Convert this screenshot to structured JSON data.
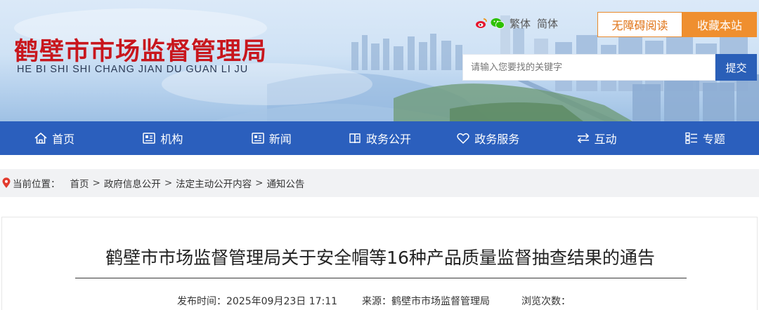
{
  "site": {
    "title": "鹤壁市市场监督管理局",
    "pinyin": "HE BI SHI SHI CHANG JIAN DU GUAN LI JU"
  },
  "header": {
    "lang_traditional": "繁体",
    "lang_simplified": "简体",
    "accessibility_label": "无障碍阅读",
    "favorite_label": "收藏本站",
    "search_placeholder": "请输入您要找的关键字",
    "search_button": "提交",
    "social_icons": [
      "weibo-icon",
      "wechat-icon"
    ]
  },
  "nav": {
    "items": [
      {
        "label": "首页",
        "icon": "home-icon"
      },
      {
        "label": "机构",
        "icon": "org-icon"
      },
      {
        "label": "新闻",
        "icon": "news-icon"
      },
      {
        "label": "政务公开",
        "icon": "gov-open-icon"
      },
      {
        "label": "政务服务",
        "icon": "heart-icon"
      },
      {
        "label": "互动",
        "icon": "interact-icon"
      },
      {
        "label": "专题",
        "icon": "topic-icon"
      }
    ]
  },
  "breadcrumb": {
    "label": "当前位置：",
    "items": [
      "首页",
      "政府信息公开",
      "法定主动公开内容",
      "通知公告"
    ],
    "separator": ">"
  },
  "article": {
    "title": "鹤壁市市场监督管理局关于安全帽等16种产品质量监督抽查结果的通告",
    "publish_time": "发布时间：2025年09月23日 17:11",
    "source": "来源：鹤壁市市场监督管理局",
    "views": "浏览次数："
  },
  "colors": {
    "brand_red": "#c8161d",
    "nav_blue": "#2b5fbd",
    "accent_orange": "#ef8f2f"
  }
}
